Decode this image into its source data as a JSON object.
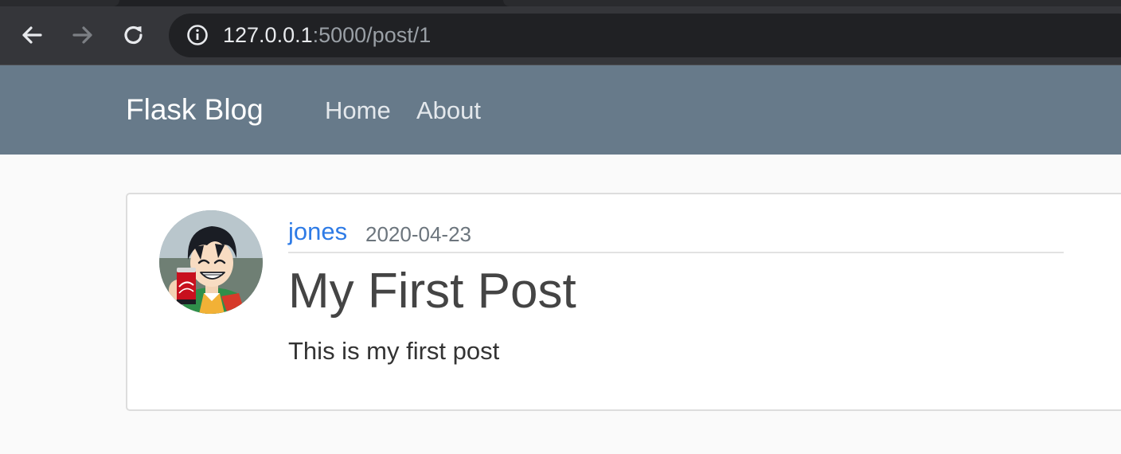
{
  "browser": {
    "url_host": "127.0.0.1",
    "url_rest": ":5000/post/1",
    "icons": {
      "back": "back-arrow-icon",
      "forward": "forward-arrow-icon",
      "reload": "reload-icon",
      "site_info": "info-icon"
    }
  },
  "navbar": {
    "brand": "Flask Blog",
    "links": [
      {
        "label": "Home"
      },
      {
        "label": "About"
      }
    ],
    "background_color": "#677a8a"
  },
  "post": {
    "author": "jones",
    "date": "2020-04-23",
    "title": "My First Post",
    "content": "This is my first post",
    "author_color": "#2e7be6"
  }
}
